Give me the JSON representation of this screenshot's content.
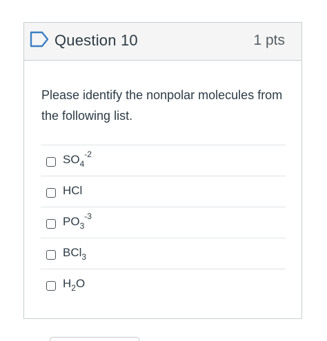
{
  "question": {
    "title": "Question 10",
    "points": "1 pts",
    "prompt": "Please identify the nonpolar molecules from the following list."
  },
  "answers": [
    {
      "base": "SO",
      "sub": "4",
      "sup": "-2",
      "tail": ""
    },
    {
      "base": "HCl",
      "sub": "",
      "sup": "",
      "tail": ""
    },
    {
      "base": "PO",
      "sub": "3",
      "sup": "-3",
      "tail": ""
    },
    {
      "base": "BCl",
      "sub": "3",
      "sup": "",
      "tail": ""
    },
    {
      "base": "H",
      "sub": "2",
      "sup": "",
      "tail": "O"
    }
  ],
  "icons": {
    "flag": "flag-outline-icon"
  },
  "colors": {
    "accent": "#3b7fc4",
    "header_bg": "#f5f5f5",
    "border": "#c7cdd1",
    "text": "#2d3b45"
  }
}
